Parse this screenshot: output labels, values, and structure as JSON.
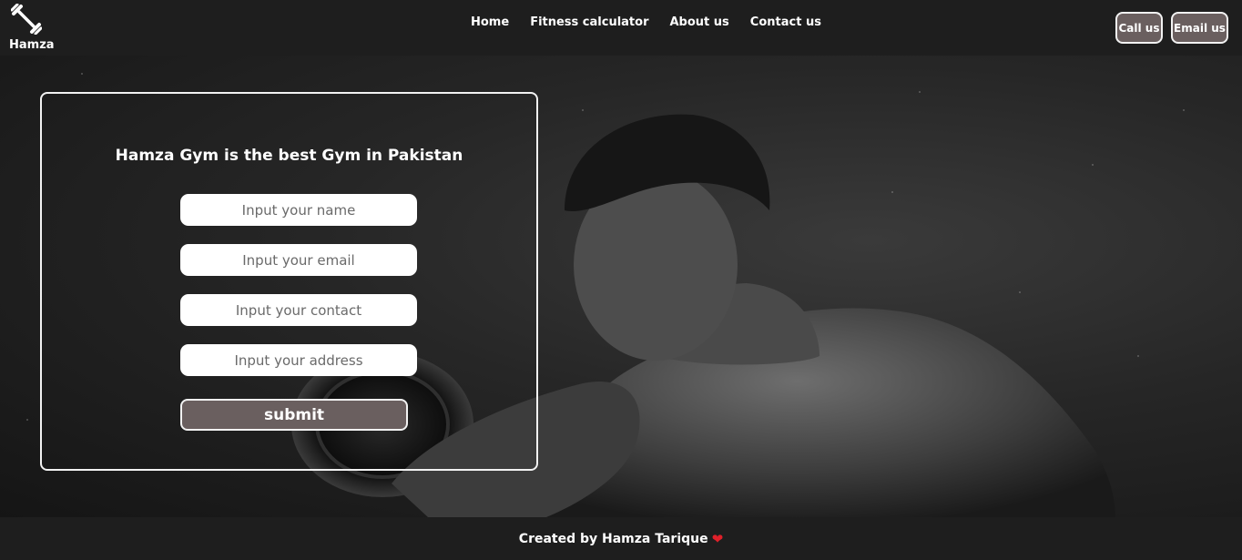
{
  "brand": {
    "label": "Hamza",
    "icon": "dumbbell-icon"
  },
  "nav": {
    "links": [
      "Home",
      "Fitness calculator",
      "About us",
      "Contact us"
    ],
    "call_label": "Call us",
    "email_label": "Email us"
  },
  "form": {
    "title": "Hamza Gym is the best Gym in Pakistan",
    "name_placeholder": "Input your name",
    "email_placeholder": "Input your email",
    "contact_placeholder": "Input your contact",
    "address_placeholder": "Input your address",
    "submit_label": "submit"
  },
  "footer": {
    "text": "Created by Hamza Tarique",
    "heart": "❤"
  },
  "colors": {
    "navbar": "#1e1e1e",
    "button": "#6a5f5f",
    "heart": "#e0202a",
    "hero": "#262626"
  }
}
